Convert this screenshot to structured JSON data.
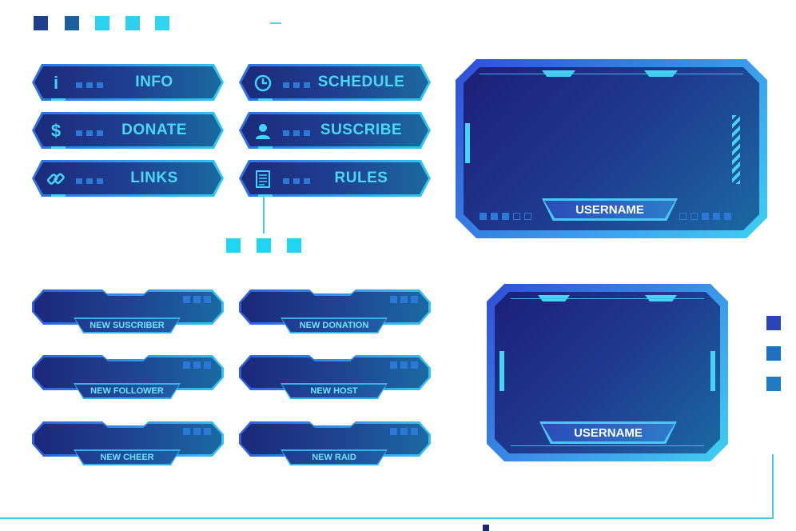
{
  "palette": [
    "#1e3f8a",
    "#1c5f9e",
    "#2ad3f0",
    "#2fd0ef",
    "#33d4f2"
  ],
  "palette_side": [
    "#2a45b8",
    "#1e6ec2",
    "#1f7bc4"
  ],
  "panel_buttons": [
    {
      "label": "INFO",
      "icon": "info-icon",
      "glyph": "i"
    },
    {
      "label": "SCHEDULE",
      "icon": "clock-icon",
      "glyph": "◷"
    },
    {
      "label": "DONATE",
      "icon": "dollar-icon",
      "glyph": "$"
    },
    {
      "label": "SUSCRIBE",
      "icon": "user-icon",
      "glyph": "👤"
    },
    {
      "label": "LINKS",
      "icon": "link-icon",
      "glyph": "⛓"
    },
    {
      "label": "RULES",
      "icon": "document-icon",
      "glyph": "▤"
    }
  ],
  "alerts": [
    {
      "label": "NEW SUSCRIBER"
    },
    {
      "label": "NEW DONATION"
    },
    {
      "label": "NEW FOLLOWER"
    },
    {
      "label": "NEW HOST"
    },
    {
      "label": "NEW CHEER"
    },
    {
      "label": "NEW RAID"
    }
  ],
  "frames": [
    {
      "username": "USERNAME"
    },
    {
      "username": "USERNAME"
    }
  ]
}
